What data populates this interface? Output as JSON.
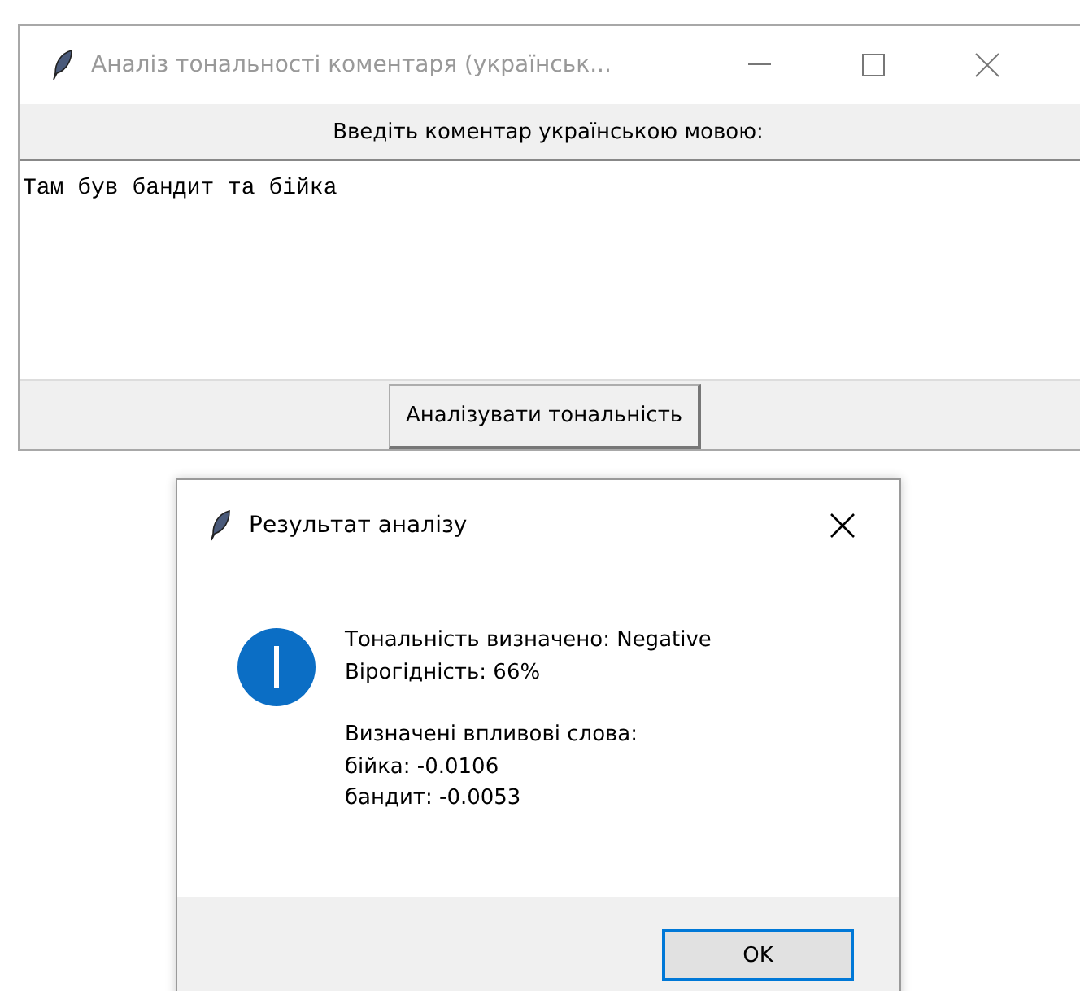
{
  "main_window": {
    "title": "Аналіз тональності коментаря (українськ...",
    "prompt": "Введіть коментар українською мовою:",
    "comment": "Там був бандит та бійка",
    "analyze_button": "Аналізувати тональність"
  },
  "dialog": {
    "title": "Результат аналізу",
    "paragraphs": [
      [
        "Тональність визначено: Negative",
        "Вірогідність: 66%"
      ],
      [
        "Визначені впливові слова:",
        "бійка: -0.0106",
        "бандит: -0.0053"
      ]
    ],
    "ok_button": "OK"
  }
}
